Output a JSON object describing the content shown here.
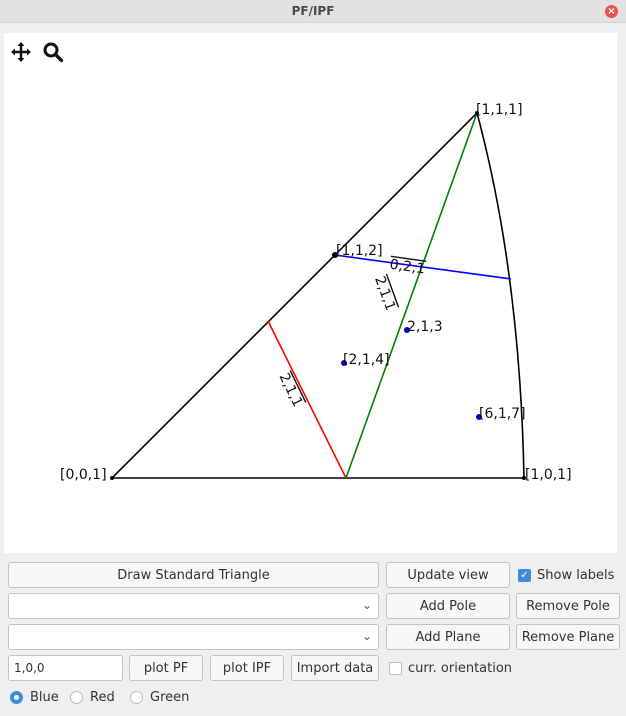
{
  "window": {
    "title": "PF/IPF",
    "close_glyph": "×"
  },
  "toolbar": {
    "icons": [
      "move-icon",
      "zoom-icon"
    ]
  },
  "chart_data": {
    "type": "diagram",
    "triangle_vertices": [
      "[0,0,1]",
      "[1,0,1]",
      "[1,1,1]"
    ],
    "poles": [
      {
        "label": "[0,0,1]",
        "color": "#000000"
      },
      {
        "label": "[1,0,1]",
        "color": "#000000"
      },
      {
        "label": "[1,1,1]",
        "color": "#000000"
      },
      {
        "label": "[1,1,2]",
        "color": "#000000"
      },
      {
        "label": "2,1,3",
        "color": "#0000cc"
      },
      {
        "label": "[2,1,4]",
        "color": "#0000cc"
      },
      {
        "label": "[6,1,7]",
        "color": "#0000cc"
      }
    ],
    "planes": [
      {
        "label": "0,2,1",
        "color": "#0000ff"
      },
      {
        "label": "2,1,1",
        "color": "#008000"
      },
      {
        "label": "2,1,1",
        "color": "#ff0000"
      }
    ],
    "colors": {
      "triangle": "#000000",
      "blue_plane": "#0000ff",
      "green_plane": "#008000",
      "red_plane": "#ff0000",
      "pole": "#0000cc"
    }
  },
  "controls": {
    "draw_triangle": "Draw Standard Triangle",
    "update_view": "Update view",
    "show_labels": {
      "label": "Show labels",
      "checked": true
    },
    "pole_select_value": "",
    "add_pole": "Add Pole",
    "remove_pole": "Remove Pole",
    "plane_select_value": "",
    "add_plane": "Add Plane",
    "remove_plane": "Remove Plane",
    "direction_input": "1,0,0",
    "plot_pf": "plot PF",
    "plot_ipf": "plot IPF",
    "import_data": "Import data",
    "curr_orientation": {
      "label": "curr. orientation",
      "checked": false
    }
  },
  "color_options": [
    {
      "label": "Blue",
      "selected": true
    },
    {
      "label": "Red",
      "selected": false
    },
    {
      "label": "Green",
      "selected": false
    }
  ]
}
